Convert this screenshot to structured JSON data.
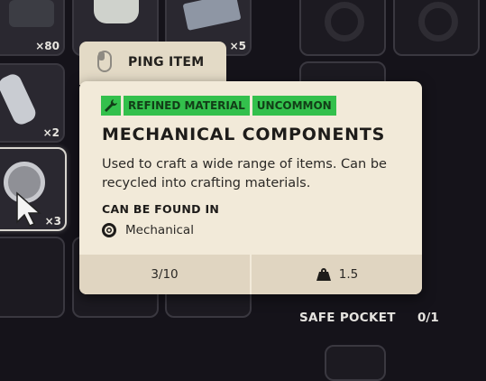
{
  "inventory": {
    "slots": [
      {
        "count": "×80"
      },
      {
        "count": "×5"
      },
      {
        "count": "×2"
      },
      {
        "count": "×3"
      }
    ]
  },
  "ping": {
    "label": "PING ITEM"
  },
  "tooltip": {
    "tags": [
      "REFINED MATERIAL",
      "UNCOMMON"
    ],
    "title": "MECHANICAL COMPONENTS",
    "description": "Used to craft a wide range of items. Can be recycled into crafting materials.",
    "found_in_label": "CAN BE FOUND IN",
    "found_in": "Mechanical",
    "stack": "3/10",
    "weight": "1.5"
  },
  "safe_pocket": {
    "label": "SAFE POCKET",
    "count": "0/1"
  },
  "colors": {
    "tag_green": "#33c04c",
    "tooltip_bg": "#f2ead9",
    "uncommon": "#33c04c"
  }
}
